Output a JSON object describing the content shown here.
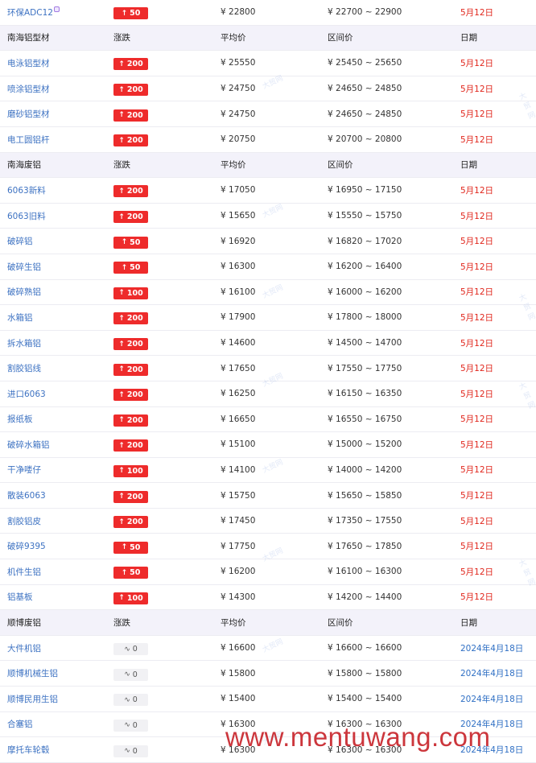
{
  "sections": [
    {
      "header": null,
      "rows": [
        {
          "name": "环保ADC12",
          "hot": true,
          "change": "50",
          "trend": "up",
          "avg": "¥  22800",
          "range": "¥  22700 ~ 22900",
          "date": "5月12日",
          "date_color": "red"
        }
      ]
    },
    {
      "header": {
        "name": "南海铝型材",
        "change": "涨跌",
        "avg": "平均价",
        "range": "区间价",
        "date": "日期"
      },
      "rows": [
        {
          "name": "电泳铝型材",
          "change": "200",
          "trend": "up",
          "avg": "¥  25550",
          "range": "¥  25450 ~ 25650",
          "date": "5月12日",
          "date_color": "red"
        },
        {
          "name": "喷涂铝型材",
          "change": "200",
          "trend": "up",
          "avg": "¥  24750",
          "range": "¥  24650 ~ 24850",
          "date": "5月12日",
          "date_color": "red"
        },
        {
          "name": "磨砂铝型材",
          "change": "200",
          "trend": "up",
          "avg": "¥  24750",
          "range": "¥  24650 ~ 24850",
          "date": "5月12日",
          "date_color": "red"
        },
        {
          "name": "电工圆铝杆",
          "change": "200",
          "trend": "up",
          "avg": "¥  20750",
          "range": "¥  20700 ~ 20800",
          "date": "5月12日",
          "date_color": "red"
        }
      ]
    },
    {
      "header": {
        "name": "南海废铝",
        "change": "涨跌",
        "avg": "平均价",
        "range": "区间价",
        "date": "日期"
      },
      "rows": [
        {
          "name": "6063新料",
          "change": "200",
          "trend": "up",
          "avg": "¥  17050",
          "range": "¥  16950 ~ 17150",
          "date": "5月12日",
          "date_color": "red"
        },
        {
          "name": "6063旧料",
          "change": "200",
          "trend": "up",
          "avg": "¥  15650",
          "range": "¥  15550 ~ 15750",
          "date": "5月12日",
          "date_color": "red"
        },
        {
          "name": "破碎铝",
          "change": "50",
          "trend": "up",
          "avg": "¥  16920",
          "range": "¥  16820 ~ 17020",
          "date": "5月12日",
          "date_color": "red"
        },
        {
          "name": "破碎生铝",
          "change": "50",
          "trend": "up",
          "avg": "¥  16300",
          "range": "¥  16200 ~ 16400",
          "date": "5月12日",
          "date_color": "red"
        },
        {
          "name": "破碎熟铝",
          "change": "100",
          "trend": "up",
          "avg": "¥  16100",
          "range": "¥  16000 ~ 16200",
          "date": "5月12日",
          "date_color": "red"
        },
        {
          "name": "水箱铝",
          "change": "200",
          "trend": "up",
          "avg": "¥  17900",
          "range": "¥  17800 ~ 18000",
          "date": "5月12日",
          "date_color": "red"
        },
        {
          "name": "拆水箱铝",
          "change": "200",
          "trend": "up",
          "avg": "¥  14600",
          "range": "¥  14500 ~ 14700",
          "date": "5月12日",
          "date_color": "red"
        },
        {
          "name": "割胶铝线",
          "change": "200",
          "trend": "up",
          "avg": "¥  17650",
          "range": "¥  17550 ~ 17750",
          "date": "5月12日",
          "date_color": "red"
        },
        {
          "name": "进口6063",
          "change": "200",
          "trend": "up",
          "avg": "¥  16250",
          "range": "¥  16150 ~ 16350",
          "date": "5月12日",
          "date_color": "red"
        },
        {
          "name": "报纸板",
          "change": "200",
          "trend": "up",
          "avg": "¥  16650",
          "range": "¥  16550 ~ 16750",
          "date": "5月12日",
          "date_color": "red"
        },
        {
          "name": "破碎水箱铝",
          "change": "200",
          "trend": "up",
          "avg": "¥  15100",
          "range": "¥  15000 ~ 15200",
          "date": "5月12日",
          "date_color": "red"
        },
        {
          "name": "干净喽仔",
          "change": "100",
          "trend": "up",
          "avg": "¥  14100",
          "range": "¥  14000 ~ 14200",
          "date": "5月12日",
          "date_color": "red"
        },
        {
          "name": "散装6063",
          "change": "200",
          "trend": "up",
          "avg": "¥  15750",
          "range": "¥  15650 ~ 15850",
          "date": "5月12日",
          "date_color": "red"
        },
        {
          "name": "割胶铝皮",
          "change": "200",
          "trend": "up",
          "avg": "¥  17450",
          "range": "¥  17350 ~ 17550",
          "date": "5月12日",
          "date_color": "red"
        },
        {
          "name": "破碎9395",
          "change": "50",
          "trend": "up",
          "avg": "¥  17750",
          "range": "¥  17650 ~ 17850",
          "date": "5月12日",
          "date_color": "red"
        },
        {
          "name": "机件生铝",
          "change": "50",
          "trend": "up",
          "avg": "¥  16200",
          "range": "¥  16100 ~ 16300",
          "date": "5月12日",
          "date_color": "red"
        },
        {
          "name": "铝基板",
          "change": "100",
          "trend": "up",
          "avg": "¥  14300",
          "range": "¥  14200 ~ 14400",
          "date": "5月12日",
          "date_color": "red"
        }
      ]
    },
    {
      "header": {
        "name": "顺博废铝",
        "change": "涨跌",
        "avg": "平均价",
        "range": "区间价",
        "date": "日期"
      },
      "rows": [
        {
          "name": "大件机铝",
          "change": "0",
          "trend": "flat",
          "avg": "¥  16600",
          "range": "¥  16600 ~ 16600",
          "date": "2024年4月18日",
          "date_color": "blue"
        },
        {
          "name": "顺博机械生铝",
          "change": "0",
          "trend": "flat",
          "avg": "¥  15800",
          "range": "¥  15800 ~ 15800",
          "date": "2024年4月18日",
          "date_color": "blue"
        },
        {
          "name": "顺博民用生铝",
          "change": "0",
          "trend": "flat",
          "avg": "¥  15400",
          "range": "¥  15400 ~ 15400",
          "date": "2024年4月18日",
          "date_color": "blue"
        },
        {
          "name": "合塞铝",
          "change": "0",
          "trend": "flat",
          "avg": "¥  16300",
          "range": "¥  16300 ~ 16300",
          "date": "2024年4月18日",
          "date_color": "blue"
        },
        {
          "name": "摩托车轮毂",
          "change": "0",
          "trend": "flat",
          "avg": "¥  16300",
          "range": "¥  16300 ~ 16300",
          "date": "2024年4月18日",
          "date_color": "blue"
        }
      ]
    }
  ],
  "icons": {
    "up": "arrow-up-icon",
    "flat": "flat-wave-icon",
    "hot": "hot-tag-icon"
  },
  "colors": {
    "up_badge": "#ee2b2b",
    "link": "#3d72c2",
    "date_red": "#e0251b",
    "date_blue": "#2f6fc4",
    "header_bg": "#f3f2fa"
  },
  "symbols": {
    "up_arrow": "↑",
    "flat_wave": "∿"
  },
  "watermark_text": "大贸网",
  "footer_watermark": "www.mentuwang.com"
}
